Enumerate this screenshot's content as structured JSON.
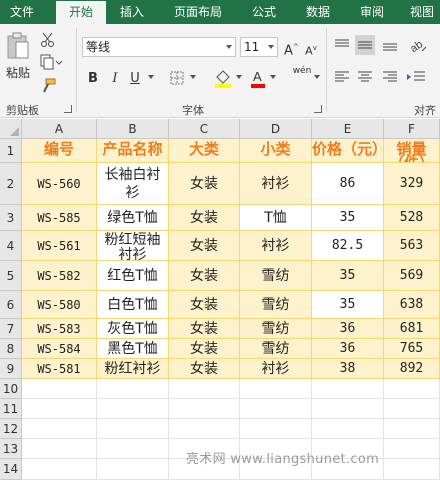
{
  "ribbon": {
    "tabs": [
      "文件",
      "开始",
      "插入",
      "页面布局",
      "公式",
      "数据",
      "审阅",
      "视图"
    ],
    "active_tab": "开始",
    "clipboard": {
      "paste_label": "粘贴",
      "group_label": "剪贴板"
    },
    "font": {
      "name": "等线",
      "size": "11",
      "bold": "B",
      "italic": "I",
      "underline": "U",
      "group_label": "字体",
      "phonetic": "wén"
    },
    "alignment": {
      "group_label": "对齐"
    },
    "colors": {
      "highlight": "#ffff00",
      "font_color": "#ff0000",
      "tab_bar": "#217346"
    }
  },
  "sheet": {
    "columns": [
      "A",
      "B",
      "C",
      "D",
      "E",
      "F"
    ],
    "row_numbers": [
      "1",
      "2",
      "3",
      "4",
      "5",
      "6",
      "7",
      "8",
      "9",
      "10",
      "11",
      "12",
      "13",
      "14"
    ],
    "header": [
      "编号",
      "产品名称",
      "大类",
      "小类",
      "价格（元）",
      "销量（件）"
    ],
    "rows": [
      [
        "WS-560",
        "长袖白衬衫",
        "女装",
        "衬衫",
        "86",
        "329"
      ],
      [
        "WS-585",
        "绿色T恤",
        "女装",
        "T恤",
        "35",
        "528"
      ],
      [
        "WS-561",
        "粉红短袖衬衫",
        "女装",
        "衬衫",
        "82.5",
        "563"
      ],
      [
        "WS-582",
        "红色T恤",
        "女装",
        "雪纺",
        "35",
        "569"
      ],
      [
        "WS-580",
        "白色T恤",
        "女装",
        "雪纺",
        "35",
        "638"
      ],
      [
        "WS-583",
        "灰色T恤",
        "女装",
        "雪纺",
        "36",
        "681"
      ],
      [
        "WS-584",
        "黑色T恤",
        "女装",
        "雪纺",
        "36",
        "765"
      ],
      [
        "WS-581",
        "粉红衬衫",
        "女装",
        "衬衫",
        "38",
        "892"
      ]
    ]
  },
  "watermark": "亮术网 www.liangshunet.com"
}
